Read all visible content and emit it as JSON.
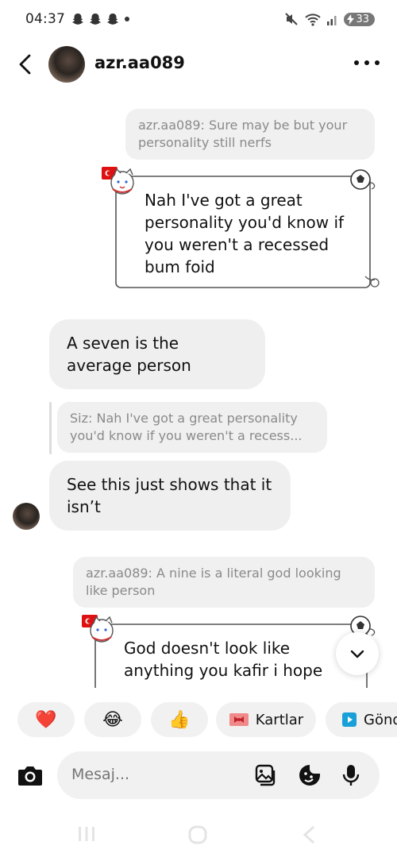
{
  "status": {
    "time": "04:37",
    "battery": "33",
    "notif_icons": [
      "snapchat-icon",
      "snapchat-icon",
      "snapchat-icon"
    ]
  },
  "header": {
    "username": "azr.aa089"
  },
  "messages": {
    "reply1": "azr.aa089: Sure may be but your personality still nerfs",
    "sticker1_text": "Nah I've got a great personality you'd know if you weren't a recessed bum foid",
    "bubble1": "A seven is the average person",
    "reply2": "Siz: Nah I've got a great personality you'd know if you weren't a recess...",
    "bubble2": "See this just shows that it isn’t",
    "reply3": "azr.aa089: A nine is a literal god looking like person",
    "sticker2_text": "God doesn't look like anything you kafir i hope"
  },
  "quick_actions": {
    "heart": "❤️",
    "laugh": "😂",
    "thumbs": "👍",
    "cards_label": "Kartlar",
    "send_label": "Gönd"
  },
  "composer": {
    "placeholder": "Mesaj..."
  },
  "colors": {
    "bubble_bg": "#efefef",
    "reply_text": "#8a8a8a",
    "card_border": "#555555"
  }
}
